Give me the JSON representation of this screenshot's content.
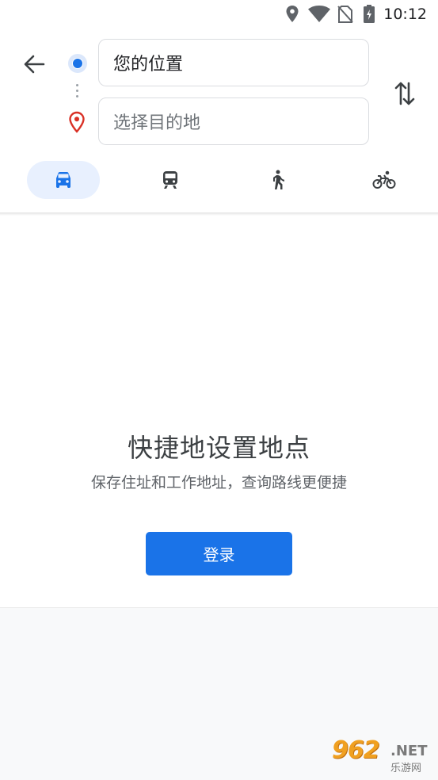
{
  "status_bar": {
    "time": "10:12",
    "icons": [
      "location-icon",
      "wifi-icon",
      "no-sim-icon",
      "battery-charging-icon"
    ]
  },
  "header": {
    "back_icon": "arrow-back-icon",
    "origin_value": "您的位置",
    "destination_placeholder": "选择目的地",
    "swap_icon": "swap-vertical-icon"
  },
  "travel_modes": [
    {
      "name": "driving",
      "icon": "car-icon",
      "active": true
    },
    {
      "name": "transit",
      "icon": "train-icon",
      "active": false
    },
    {
      "name": "walking",
      "icon": "walk-icon",
      "active": false
    },
    {
      "name": "cycling",
      "icon": "bicycle-icon",
      "active": false
    }
  ],
  "empty_state": {
    "title": "快捷地设置地点",
    "subtitle": "保存住址和工作地址，查询路线更便捷",
    "login_label": "登录"
  },
  "watermark": {
    "number": "962",
    "suffix": ".NET",
    "site_name": "乐游网"
  },
  "colors": {
    "accent": "#1a73e8",
    "active_mode_bg": "#e8f0fe",
    "pin_red": "#d93025",
    "icon_gray": "#3c4043"
  }
}
